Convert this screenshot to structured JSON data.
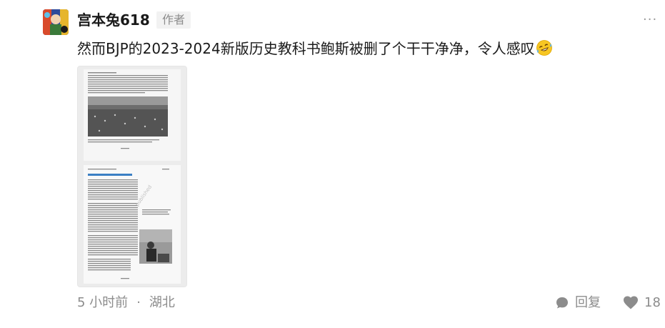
{
  "comment": {
    "username": "宫本兔618",
    "author_tag": "作者",
    "more_label": "···",
    "text": "然而BJP的2023-2024新版历史教科书鲍斯被删了个干干净净，令人感叹",
    "emoji": "rolling-on-floor-laughing-emoji",
    "image_alt": "textbook-pages-photo",
    "time": "5 小时前",
    "separator": "·",
    "location": "湖北",
    "reply_label": "回复",
    "like_count": "18"
  },
  "colors": {
    "text": "#1a1a1a",
    "muted": "#8c8c8c",
    "tag_bg": "#f2f2f2"
  }
}
